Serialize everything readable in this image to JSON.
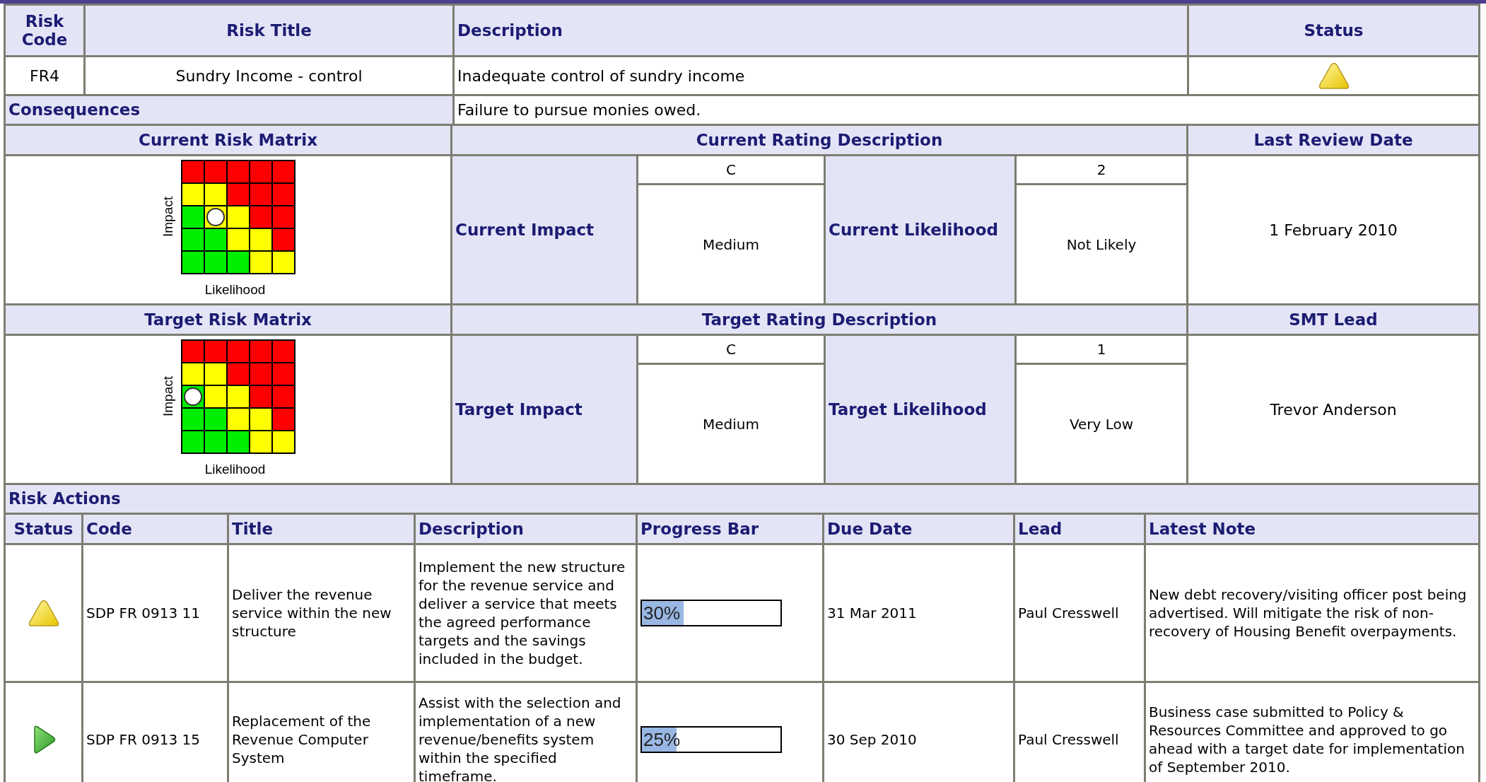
{
  "risk": {
    "headers": [
      "Risk Code",
      "Risk Title",
      "Description",
      "Status"
    ],
    "code": "FR4",
    "title": "Sundry Income - control",
    "description": "Inadequate control of sundry income",
    "kind": "amber",
    "consequences_label": "Consequences",
    "consequences": "Failure to pursue monies owed."
  },
  "sections": [
    {
      "matrix_title": "Current Risk Matrix",
      "rating_title": "Current Rating Description",
      "side_title": "Last Review Date",
      "impact_label": "Current Impact",
      "impact_code": "C",
      "impact_text": "Medium",
      "likelihood_label": "Current Likelihood",
      "likelihood_code": "2",
      "likelihood_text": "Not Likely",
      "side_value": "1 February 2010",
      "axis_y": "Impact",
      "axis_x": "Likelihood"
    },
    {
      "matrix_title": "Target Risk Matrix",
      "rating_title": "Target Rating Description",
      "side_title": "SMT Lead",
      "impact_label": "Target Impact",
      "impact_code": "C",
      "impact_text": "Medium",
      "likelihood_label": "Target Likelihood",
      "likelihood_code": "1",
      "likelihood_text": "Very Low",
      "side_value": "Trevor Anderson",
      "axis_y": "Impact",
      "axis_x": "Likelihood"
    }
  ],
  "actions": {
    "title": "Risk Actions",
    "columns": [
      "Status",
      "Code",
      "Title",
      "Description",
      "Progress Bar",
      "Due Date",
      "Lead",
      "Latest Note"
    ],
    "rows": [
      {
        "kind": "amber",
        "code": "SDP FR 0913 11",
        "title": "Deliver the revenue service within the new structure",
        "description": "Implement the new structure for the revenue service and deliver a service that meets the agreed performance targets and the savings included in the budget.",
        "level": 0.3,
        "progress": "30%",
        "due": "31 Mar 2011",
        "lead": "Paul Cresswell",
        "note": "New debt recovery/visiting officer post being advertised. Will mitigate the risk of non-recovery of Housing Benefit overpayments."
      },
      {
        "kind": "green",
        "code": "SDP FR 0913 15",
        "title": "Replacement of the Revenue Computer System",
        "description": "Assist with the selection and implementation of a new revenue/benefits system within the specified timeframe.",
        "level": 0.25,
        "progress": "25%",
        "due": "30 Sep 2010",
        "lead": "Paul Cresswell",
        "note": "Business case submitted to Policy & Resources Committee and approved to go ahead with a target date for implementation of September 2010."
      }
    ]
  }
}
